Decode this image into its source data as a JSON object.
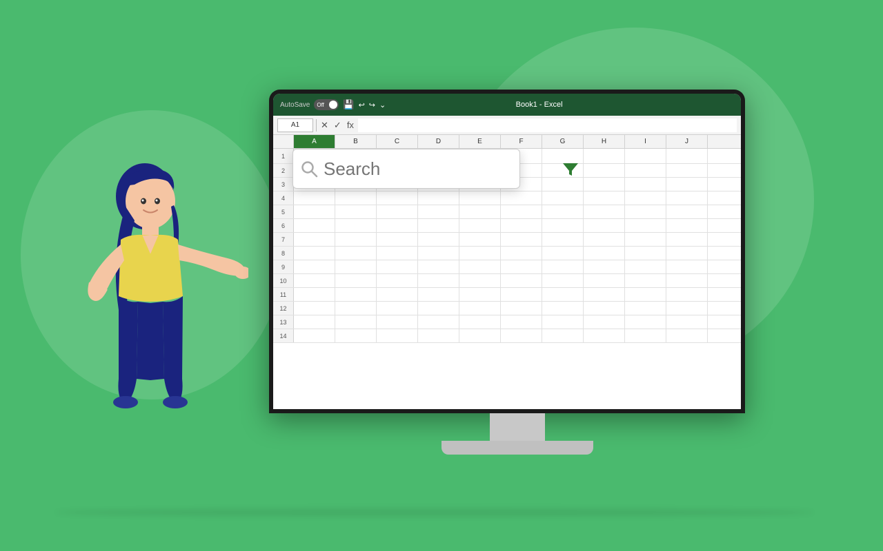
{
  "background": {
    "color": "#4aba6e"
  },
  "excel": {
    "titlebar": {
      "autosave_label": "AutoSave",
      "toggle_state": "Off",
      "title": "Book1  -  Excel"
    },
    "formula_bar": {
      "cell_ref": "A1",
      "fx_label": "fx"
    },
    "columns": [
      "A",
      "B",
      "C",
      "D",
      "E",
      "F",
      "G",
      "H",
      "I",
      "J"
    ],
    "rows": [
      1,
      2,
      3,
      4,
      5,
      6,
      7,
      8,
      9,
      10,
      11,
      12,
      13,
      14
    ],
    "active_col": "A"
  },
  "search_bar": {
    "placeholder": "Search",
    "search_icon": "search",
    "filter_icon": "filter"
  }
}
